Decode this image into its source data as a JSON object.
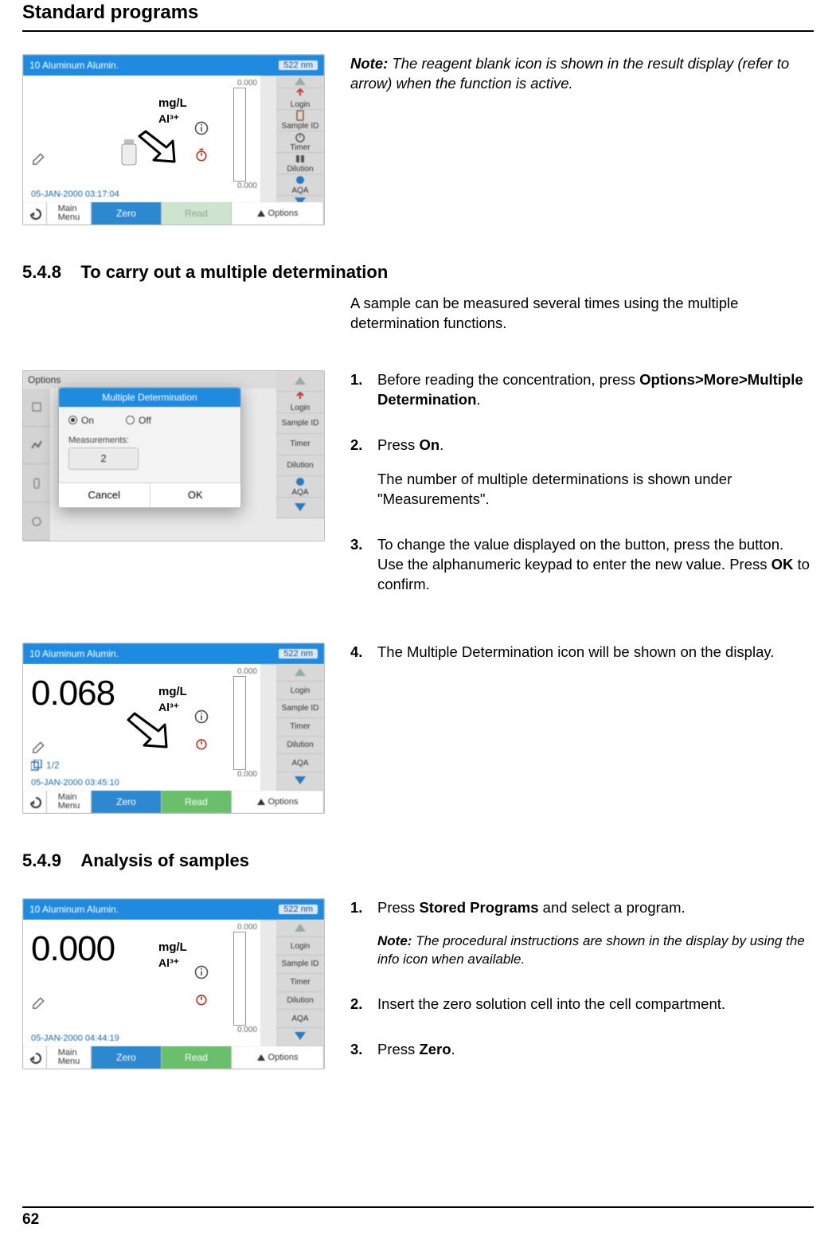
{
  "page": {
    "running_head": "Standard programs",
    "page_number": "62"
  },
  "sections": {
    "s548": {
      "num": "5.4.8",
      "title": "To carry out a multiple determination"
    },
    "s549": {
      "num": "5.4.9",
      "title": "Analysis of samples"
    }
  },
  "intro_548": "A sample can be measured several times using the multiple determination functions.",
  "note_top_label": "Note:",
  "note_top": " The reagent blank icon is shown in the result display (refer to arrow) when the function is active.",
  "steps548": [
    {
      "n": "1.",
      "text": "Before reading the concentration, press ",
      "bold_after": "Options>More>Multiple Determination",
      "suffix": "."
    },
    {
      "n": "2.",
      "text": "Press ",
      "bold_after": "On",
      "suffix": ".",
      "follow": "The number of multiple determinations is shown under \"Measurements\"."
    },
    {
      "n": "3.",
      "text": "To change the value displayed on the button, press the button. Use the alphanumeric keypad to enter the new value. Press ",
      "bold_after": "OK",
      "suffix": " to confirm."
    }
  ],
  "step548_4": {
    "n": "4.",
    "text": "The Multiple Determination icon will be shown on the display."
  },
  "steps549": {
    "s1": {
      "n": "1.",
      "text": "Press ",
      "bold_after": "Stored Programs",
      "suffix": " and select a program."
    },
    "s1_note_label": "Note:",
    "s1_note": " The procedural instructions are shown in the display by using the info icon when available.",
    "s2": {
      "n": "2.",
      "text": "Insert the zero solution cell into the cell compartment."
    },
    "s3": {
      "n": "3.",
      "text": "Press ",
      "bold_after": "Zero",
      "suffix": "."
    }
  },
  "device": {
    "program_title": "10 Aluminum Alumin.",
    "wavelength": "522 nm",
    "units": "mg/L",
    "element": "Al³⁺",
    "scale_top": "0.000",
    "scale_bottom": "0.000",
    "timestamp1": "05-JAN-2000  03:17:04",
    "timestamp3": "05-JAN-2000  03:45:10",
    "timestamp4": "05-JAN-2000  04:44:19",
    "reading3": "0.068",
    "reading4": "0.000",
    "multi_badge": "1/2",
    "bottom": {
      "main": "Main\nMenu",
      "zero": "Zero",
      "read": "Read",
      "options": "Options"
    },
    "right_panel": [
      "Login",
      "Sample ID",
      "Timer",
      "Dilution",
      "AQA"
    ],
    "modal": {
      "options_label": "Options",
      "title": "Multiple Determination",
      "on": "On",
      "off": "Off",
      "meas_label": "Measurements:",
      "meas_value": "2",
      "cancel": "Cancel",
      "ok": "OK"
    }
  }
}
